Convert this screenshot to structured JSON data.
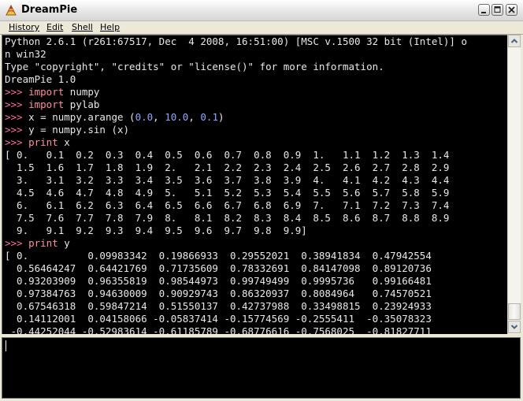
{
  "window": {
    "title": "DreamPie",
    "controls": {
      "minimize": "minimize-icon",
      "maximize": "maximize-icon",
      "close": "close-icon"
    }
  },
  "menu": [
    {
      "label": "History"
    },
    {
      "label": "Edit"
    },
    {
      "label": "Shell"
    },
    {
      "label": "Help"
    }
  ],
  "colors": {
    "background": "#000000",
    "text": "#e8e8e8",
    "prompt": "#ff6aa6",
    "keyword": "#ff8fa0",
    "number": "#8fa8ff"
  },
  "output_lines": [
    [
      {
        "t": "Python 2.6.1 (r261:67517, Dec  4 2008, 16:51:00) [MSC v.1500 32 bit (Intel)] o"
      }
    ],
    [
      {
        "t": "n win32"
      }
    ],
    [
      {
        "t": "Type \"copyright\", \"credits\" or \"license()\" for more information."
      }
    ],
    [
      {
        "t": "DreamPie 1.0"
      }
    ],
    [
      {
        "t": ">>> ",
        "c": "prompt"
      },
      {
        "t": "import",
        "c": "kw"
      },
      {
        "t": " numpy"
      }
    ],
    [
      {
        "t": ">>> ",
        "c": "prompt"
      },
      {
        "t": "import",
        "c": "kw"
      },
      {
        "t": " pylab"
      }
    ],
    [
      {
        "t": ">>> ",
        "c": "prompt"
      },
      {
        "t": "x = numpy.arange ("
      },
      {
        "t": "0.0",
        "c": "num"
      },
      {
        "t": ", "
      },
      {
        "t": "10.0",
        "c": "num"
      },
      {
        "t": ", "
      },
      {
        "t": "0.1",
        "c": "num"
      },
      {
        "t": ")"
      }
    ],
    [
      {
        "t": ">>> ",
        "c": "prompt"
      },
      {
        "t": "y = numpy.sin (x)"
      }
    ],
    [
      {
        "t": ">>> ",
        "c": "prompt"
      },
      {
        "t": "print",
        "c": "kw"
      },
      {
        "t": " x"
      }
    ],
    [
      {
        "t": "[ 0.   0.1  0.2  0.3  0.4  0.5  0.6  0.7  0.8  0.9  1.   1.1  1.2  1.3  1.4"
      }
    ],
    [
      {
        "t": "  1.5  1.6  1.7  1.8  1.9  2.   2.1  2.2  2.3  2.4  2.5  2.6  2.7  2.8  2.9"
      }
    ],
    [
      {
        "t": "  3.   3.1  3.2  3.3  3.4  3.5  3.6  3.7  3.8  3.9  4.   4.1  4.2  4.3  4.4"
      }
    ],
    [
      {
        "t": "  4.5  4.6  4.7  4.8  4.9  5.   5.1  5.2  5.3  5.4  5.5  5.6  5.7  5.8  5.9"
      }
    ],
    [
      {
        "t": "  6.   6.1  6.2  6.3  6.4  6.5  6.6  6.7  6.8  6.9  7.   7.1  7.2  7.3  7.4"
      }
    ],
    [
      {
        "t": "  7.5  7.6  7.7  7.8  7.9  8.   8.1  8.2  8.3  8.4  8.5  8.6  8.7  8.8  8.9"
      }
    ],
    [
      {
        "t": "  9.   9.1  9.2  9.3  9.4  9.5  9.6  9.7  9.8  9.9]"
      }
    ],
    [
      {
        "t": ">>> ",
        "c": "prompt"
      },
      {
        "t": "print",
        "c": "kw"
      },
      {
        "t": " y"
      }
    ],
    [
      {
        "t": "[ 0.          0.09983342  0.19866933  0.29552021  0.38941834  0.47942554"
      }
    ],
    [
      {
        "t": "  0.56464247  0.64421769  0.71735609  0.78332691  0.84147098  0.89120736"
      }
    ],
    [
      {
        "t": "  0.93203909  0.96355819  0.98544973  0.99749499  0.9995736   0.99166481"
      }
    ],
    [
      {
        "t": "  0.97384763  0.94630009  0.90929743  0.86320937  0.8084964   0.74570521"
      }
    ],
    [
      {
        "t": "  0.67546318  0.59847214  0.51550137  0.42737988  0.33498815  0.23924933"
      }
    ],
    [
      {
        "t": "  0.14112001  0.04158066 -0.05837414 -0.15774569 -0.2555411  -0.35078323"
      }
    ],
    [
      {
        "t": " -0.44252044 -0.52983614 -0.61185789 -0.68776616 -0.7568025  -0.81827711"
      }
    ]
  ],
  "input": {
    "value": ""
  }
}
